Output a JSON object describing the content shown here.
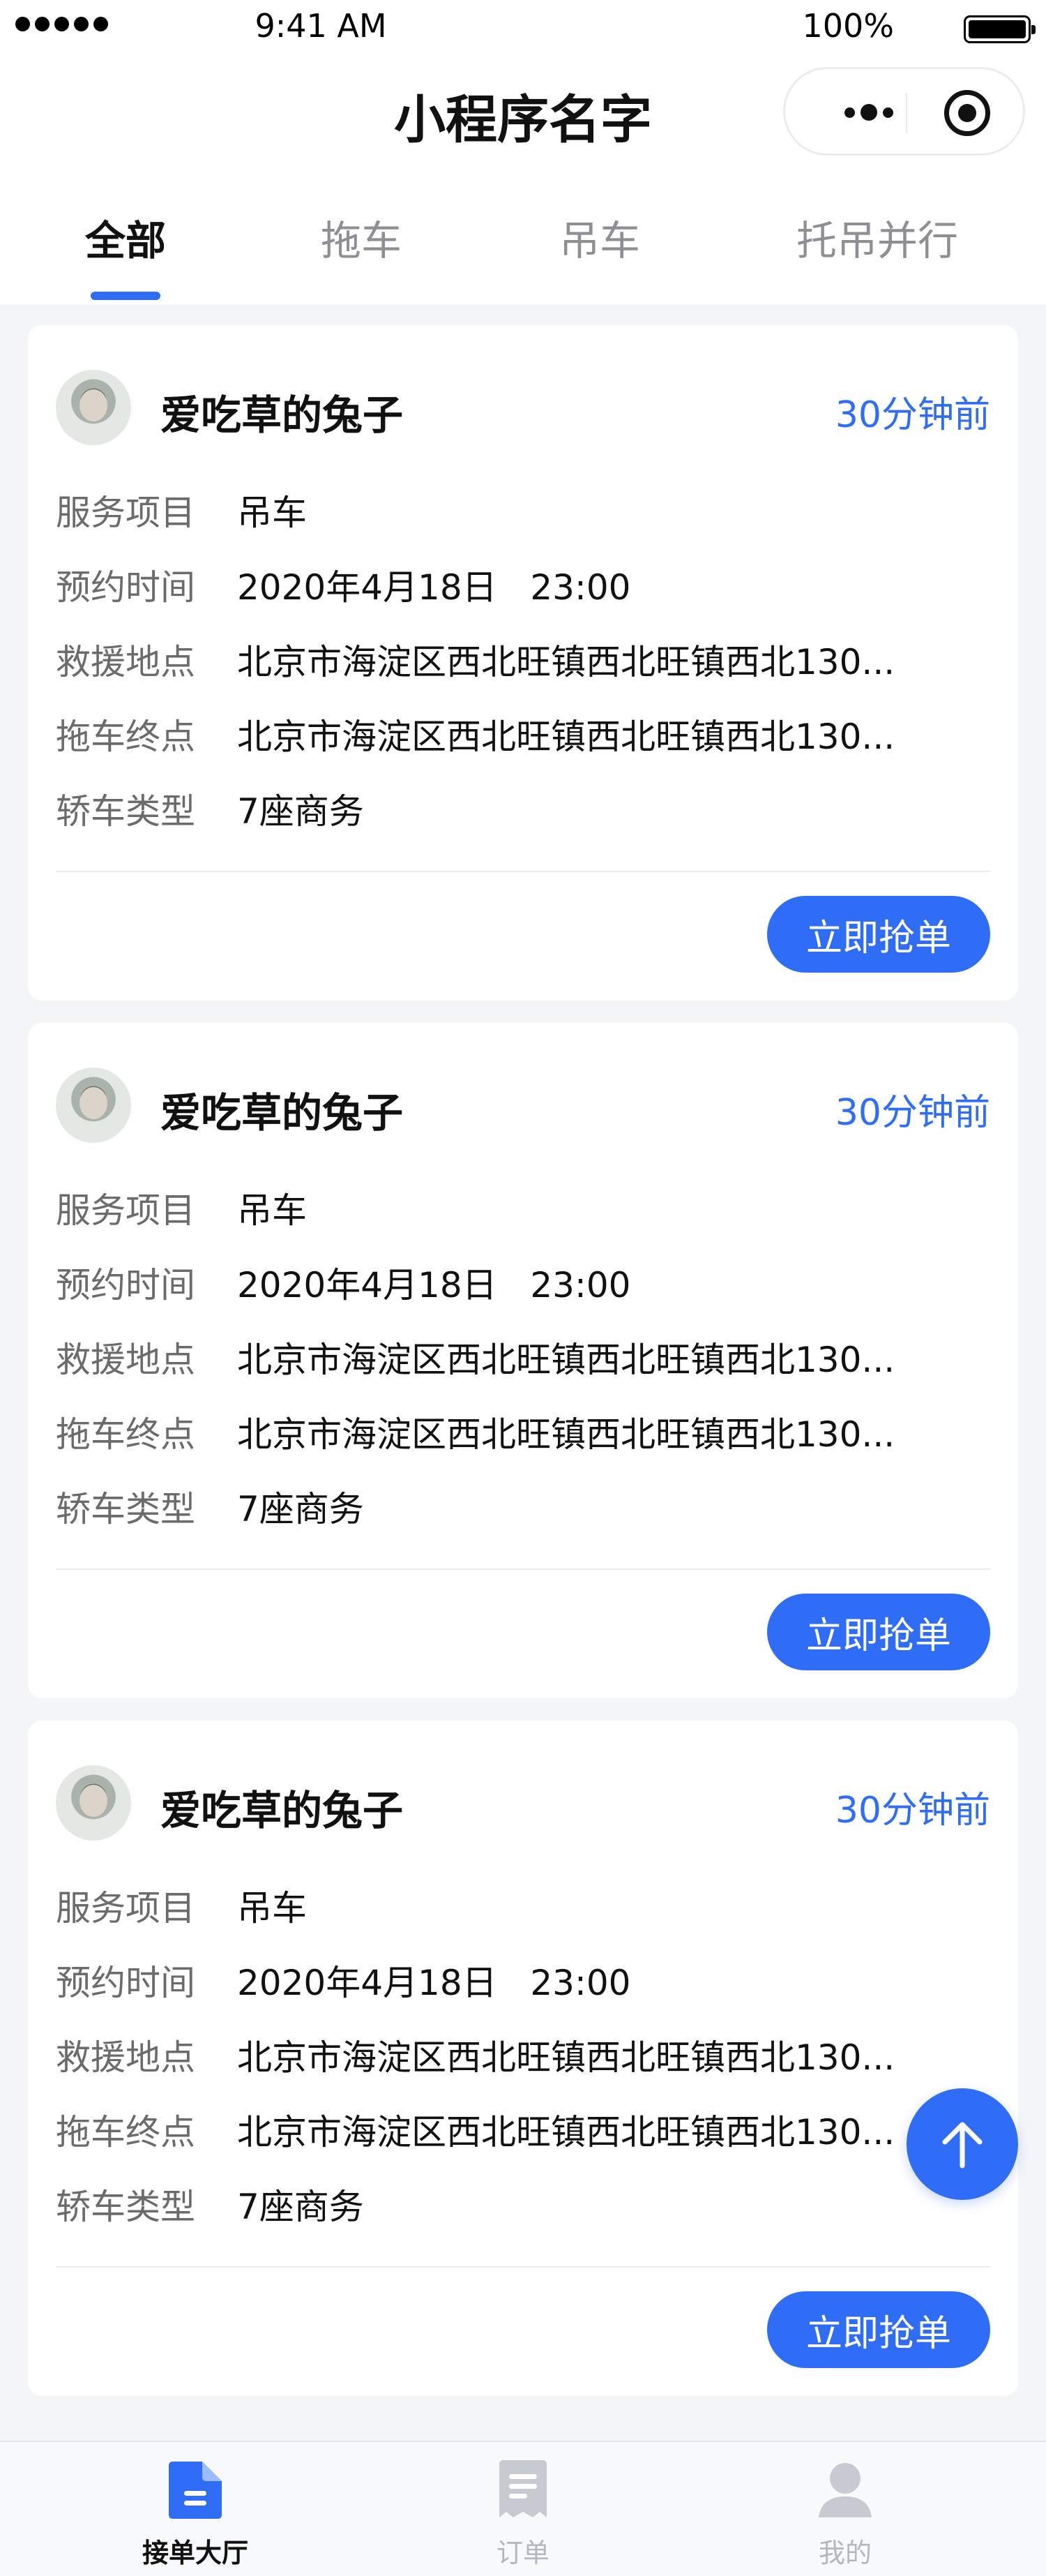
{
  "status_bar": {
    "time": "9:41 AM",
    "battery_percent": "100%",
    "signal_bars": 5,
    "battery_level": 1.0
  },
  "nav": {
    "title": "小程序名字"
  },
  "tabs": [
    {
      "label": "全部",
      "active": true
    },
    {
      "label": "拖车",
      "active": false
    },
    {
      "label": "吊车",
      "active": false
    },
    {
      "label": "托吊并行",
      "active": false
    }
  ],
  "orders": [
    {
      "user": "爱吃草的兔子",
      "time_ago": "30分钟前",
      "fields": [
        {
          "label": "服务项目",
          "value": "吊车"
        },
        {
          "label": "预约时间",
          "value": "2020年4月18日   23:00"
        },
        {
          "label": "救援地点",
          "value": "北京市海淀区西北旺镇西北旺镇西北130..."
        },
        {
          "label": "拖车终点",
          "value": "北京市海淀区西北旺镇西北旺镇西北130..."
        },
        {
          "label": "轿车类型",
          "value": "7座商务"
        }
      ],
      "action": "立即抢单"
    },
    {
      "user": "爱吃草的兔子",
      "time_ago": "30分钟前",
      "fields": [
        {
          "label": "服务项目",
          "value": "吊车"
        },
        {
          "label": "预约时间",
          "value": "2020年4月18日   23:00"
        },
        {
          "label": "救援地点",
          "value": "北京市海淀区西北旺镇西北旺镇西北130..."
        },
        {
          "label": "拖车终点",
          "value": "北京市海淀区西北旺镇西北旺镇西北130..."
        },
        {
          "label": "轿车类型",
          "value": "7座商务"
        }
      ],
      "action": "立即抢单"
    },
    {
      "user": "爱吃草的兔子",
      "time_ago": "30分钟前",
      "fields": [
        {
          "label": "服务项目",
          "value": "吊车"
        },
        {
          "label": "预约时间",
          "value": "2020年4月18日   23:00"
        },
        {
          "label": "救援地点",
          "value": "北京市海淀区西北旺镇西北旺镇西北130..."
        },
        {
          "label": "拖车终点",
          "value": "北京市海淀区西北旺镇西北旺镇西北130..."
        },
        {
          "label": "轿车类型",
          "value": "7座商务"
        }
      ],
      "action": "立即抢单"
    }
  ],
  "bottom_tabs": [
    {
      "label": "接单大厅",
      "icon": "document-list-icon",
      "active": true
    },
    {
      "label": "订单",
      "icon": "receipt-icon",
      "active": false
    },
    {
      "label": "我的",
      "icon": "user-profile-icon",
      "active": false
    }
  ],
  "colors": {
    "accent": "#2f6df6",
    "inactive": "#b3b7c0",
    "background": "#f4f5f7"
  }
}
